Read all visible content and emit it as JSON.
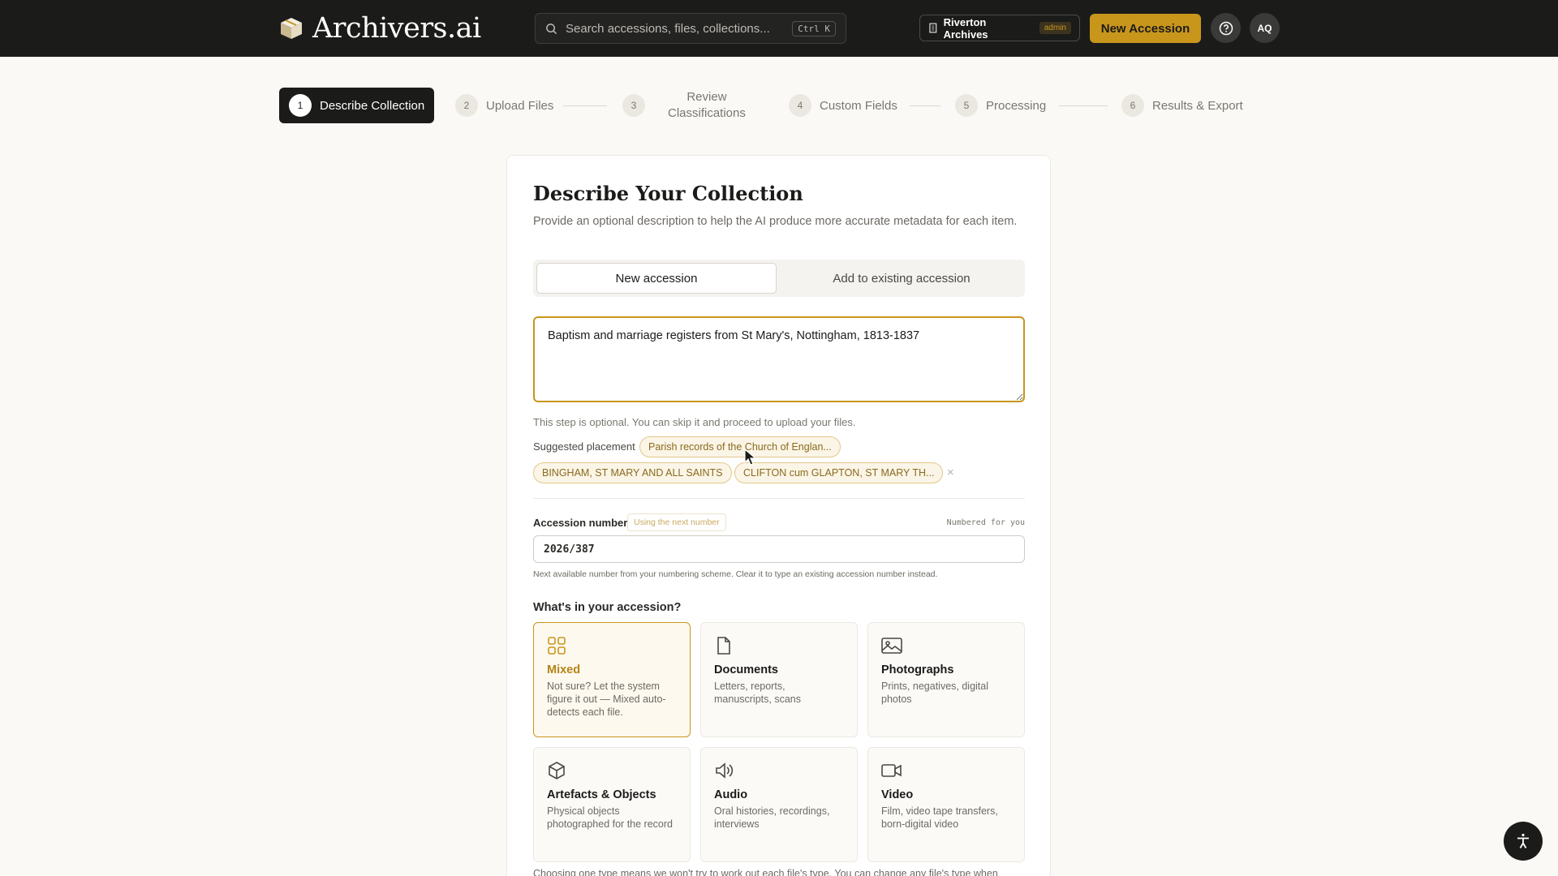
{
  "header": {
    "logo_text": "Archivers.ai",
    "search_placeholder": "Search accessions, files, collections...",
    "search_shortcut": "Ctrl K",
    "org_name": "Riverton Archives",
    "org_role": "admin",
    "new_accession_label": "New Accession",
    "avatar_initials": "AQ",
    "accent_color": "#c9961c"
  },
  "stepper": {
    "steps": [
      {
        "num": "1",
        "label": "Describe Collection"
      },
      {
        "num": "2",
        "label": "Upload Files"
      },
      {
        "num": "3",
        "label_line1": "Review",
        "label_line2": "Classifications"
      },
      {
        "num": "4",
        "label": "Custom Fields"
      },
      {
        "num": "5",
        "label": "Processing"
      },
      {
        "num": "6",
        "label": "Results & Export"
      }
    ],
    "active_step": 1
  },
  "form": {
    "title": "Describe Your Collection",
    "subtitle": "Provide an optional description to help the AI produce more accurate metadata for each item.",
    "segments": [
      "New accession",
      "Add to existing accession"
    ],
    "active_segment": 0,
    "description_value": "Baptism and marriage registers from St Mary's, Nottingham, 1813-1837",
    "optional_hint": "This step is optional. You can skip it and proceed to upload your files.",
    "suggested_label": "Suggested placement",
    "suggestions": [
      "Parish records of the Church of Englan...",
      "BINGHAM, ST MARY AND ALL SAINTS",
      "CLIFTON cum GLAPTON, ST MARY TH..."
    ],
    "dismiss_symbol": "×",
    "accession_label": "Accession number",
    "accession_tag": "Using the next number",
    "accession_right_note": "Numbered for you",
    "accession_value": "2026/387",
    "accession_help": "Next available number from your numbering scheme. Clear it to type an existing accession number instead.",
    "contents_question": "What's in your accession?",
    "types": [
      {
        "title": "Mixed",
        "desc": "Not sure? Let the system figure it out — Mixed auto-detects each file.",
        "icon": "grid-icon"
      },
      {
        "title": "Documents",
        "desc": "Letters, reports, manuscripts, scans",
        "icon": "document-icon"
      },
      {
        "title": "Photographs",
        "desc": "Prints, negatives, digital photos",
        "icon": "image-icon"
      },
      {
        "title": "Artefacts & Objects",
        "desc": "Physical objects photographed for the record",
        "icon": "cube-icon"
      },
      {
        "title": "Audio",
        "desc": "Oral histories, recordings, interviews",
        "icon": "speaker-icon"
      },
      {
        "title": "Video",
        "desc": "Film, video tape transfers, born-digital video",
        "icon": "video-icon"
      }
    ],
    "selected_type": "Mixed",
    "footer_note": "Choosing one type means we won't try to work out each file's type. You can change any file's type when"
  }
}
